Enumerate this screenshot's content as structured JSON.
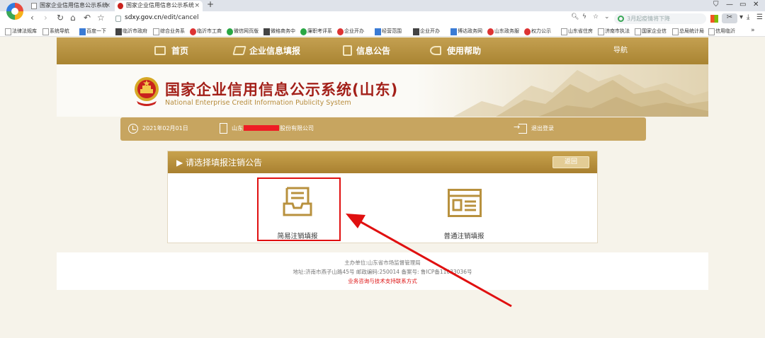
{
  "browser": {
    "tabs": [
      {
        "title": "国家企业信用信息公示系统",
        "active": false
      },
      {
        "title": "国家企业信用信息公示系统",
        "active": true
      }
    ],
    "url_host": "sdxy.gov.cn",
    "url_path": "/edit/cancel",
    "search_placeholder": "3月起疫情将下降",
    "bookmarks": [
      "法律法规库",
      "系统导航",
      "百度一下",
      "临沂市政府",
      "综合业务系",
      "临沂市工商",
      "微信网页版",
      "微格商务中",
      "廉职考评系",
      "企业开办",
      "经营范围",
      "企业开办",
      "博达政务网",
      "山东政务服",
      "权力公示",
      "山东省住房",
      "济南市执法",
      "国家企业信",
      "总局统计局",
      "信用临沂"
    ]
  },
  "nav": {
    "items": [
      {
        "label": "首页",
        "icon": "monitor-icon"
      },
      {
        "label": "企业信息填报",
        "icon": "edit-icon"
      },
      {
        "label": "信息公告",
        "icon": "document-icon"
      },
      {
        "label": "使用帮助",
        "icon": "speaker-icon"
      }
    ],
    "guide_label": "导航"
  },
  "banner": {
    "title_cn": "国家企业信用信息公示系统(山东)",
    "title_en": "National Enterprise Credit Information Publicity System"
  },
  "infobar": {
    "date": "2021年02月01日",
    "company_prefix": "山东",
    "company_suffix": "股份有限公司",
    "logout_label": "退出登录"
  },
  "panel": {
    "title": "▶ 请选择填报注销公告",
    "back_label": "返回",
    "options": [
      {
        "label": "简易注销填报",
        "icon": "inbox-tray-icon"
      },
      {
        "label": "普通注销填报",
        "icon": "form-list-icon"
      }
    ]
  },
  "footer": {
    "sponsor": "主办单位:山东省市场监督管理局",
    "address": "地址:济南市燕子山路45号    邮政编码:250014    备案号: 鲁ICP备11033036号",
    "support": "业务咨询与技术支持联系方式"
  },
  "colors": {
    "nav_gold": "#b8913e",
    "title_red": "#a32019",
    "highlight_red": "#e01010"
  }
}
